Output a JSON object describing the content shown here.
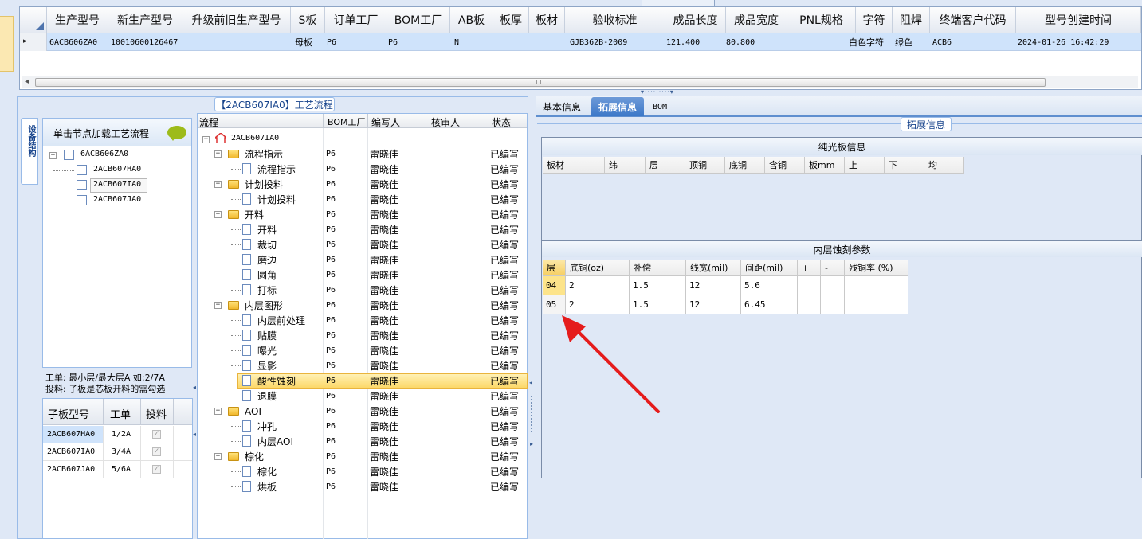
{
  "top_grid": {
    "columns": [
      "生产型号",
      "新生产型号",
      "升级前旧生产型号",
      "S板",
      "订单工厂",
      "BOM工厂",
      "AB板",
      "板厚",
      "板材",
      "验收标准",
      "成品长度",
      "成品宽度",
      "PNL规格",
      "字符",
      "阻焊",
      "终端客户代码",
      "型号创建时间"
    ],
    "row": {
      "prod_model": "6ACB606ZA0",
      "new_model": "10010600126467",
      "old_model": "",
      "s_board": "母板",
      "order_factory": "P6",
      "bom_factory": "P6",
      "ab_board": "N",
      "thickness": "",
      "material": "",
      "standard": "GJB362B-2009",
      "length": "121.400",
      "width": "80.800",
      "pnl": "",
      "char": "白色字符",
      "mask": "绿色",
      "customer": "ACB6",
      "created": "2024-01-26 16:42:29"
    }
  },
  "side_tab": {
    "label": "设备结构"
  },
  "left_panel": {
    "hint": "单击节点加载工艺流程",
    "tree": {
      "root": "6ACB606ZA0",
      "children": [
        "2ACB607HA0",
        "2ACB607IA0",
        "2ACB607JA0"
      ]
    },
    "notes": [
      "工单: 最小层/最大层A 如:2/7A",
      "投料: 子板是芯板开料的需勾选"
    ],
    "sub_table": {
      "headers": [
        "子板型号",
        "工单",
        "投料"
      ],
      "rows": [
        {
          "model": "2ACB607HA0",
          "order": "1/2A",
          "checked": "✓"
        },
        {
          "model": "2ACB607IA0",
          "order": "3/4A",
          "checked": "✓"
        },
        {
          "model": "2ACB607JA0",
          "order": "5/6A",
          "checked": "✓"
        }
      ]
    }
  },
  "process_panel": {
    "title": "【2ACB607IA0】工艺流程",
    "headers": [
      "流程",
      "BOM工厂",
      "编写人",
      "核审人",
      "状态"
    ],
    "root": "2ACB607IA0",
    "rows": [
      {
        "name": "流程指示",
        "level": 1,
        "type": "folder",
        "bom": "P6",
        "writer": "雷晓佳",
        "status": "已编写"
      },
      {
        "name": "流程指示",
        "level": 2,
        "type": "file",
        "bom": "P6",
        "writer": "雷晓佳",
        "status": "已编写"
      },
      {
        "name": "计划投料",
        "level": 1,
        "type": "folder",
        "bom": "P6",
        "writer": "雷晓佳",
        "status": "已编写"
      },
      {
        "name": "计划投料",
        "level": 2,
        "type": "file",
        "bom": "P6",
        "writer": "雷晓佳",
        "status": "已编写"
      },
      {
        "name": "开料",
        "level": 1,
        "type": "folder",
        "bom": "P6",
        "writer": "雷晓佳",
        "status": "已编写"
      },
      {
        "name": "开料",
        "level": 2,
        "type": "file",
        "bom": "P6",
        "writer": "雷晓佳",
        "status": "已编写"
      },
      {
        "name": "裁切",
        "level": 2,
        "type": "file",
        "bom": "P6",
        "writer": "雷晓佳",
        "status": "已编写"
      },
      {
        "name": "磨边",
        "level": 2,
        "type": "file",
        "bom": "P6",
        "writer": "雷晓佳",
        "status": "已编写"
      },
      {
        "name": "圆角",
        "level": 2,
        "type": "file",
        "bom": "P6",
        "writer": "雷晓佳",
        "status": "已编写"
      },
      {
        "name": "打标",
        "level": 2,
        "type": "file",
        "bom": "P6",
        "writer": "雷晓佳",
        "status": "已编写"
      },
      {
        "name": "内层图形",
        "level": 1,
        "type": "folder",
        "bom": "P6",
        "writer": "雷晓佳",
        "status": "已编写"
      },
      {
        "name": "内层前处理",
        "level": 2,
        "type": "file",
        "bom": "P6",
        "writer": "雷晓佳",
        "status": "已编写"
      },
      {
        "name": "贴膜",
        "level": 2,
        "type": "file",
        "bom": "P6",
        "writer": "雷晓佳",
        "status": "已编写"
      },
      {
        "name": "曝光",
        "level": 2,
        "type": "file",
        "bom": "P6",
        "writer": "雷晓佳",
        "status": "已编写"
      },
      {
        "name": "显影",
        "level": 2,
        "type": "file",
        "bom": "P6",
        "writer": "雷晓佳",
        "status": "已编写"
      },
      {
        "name": "酸性蚀刻",
        "level": 2,
        "type": "file",
        "bom": "P6",
        "writer": "雷晓佳",
        "status": "已编写"
      },
      {
        "name": "退膜",
        "level": 2,
        "type": "file",
        "bom": "P6",
        "writer": "雷晓佳",
        "status": "已编写"
      },
      {
        "name": "AOI",
        "level": 1,
        "type": "folder",
        "bom": "P6",
        "writer": "雷晓佳",
        "status": "已编写"
      },
      {
        "name": "冲孔",
        "level": 2,
        "type": "file",
        "bom": "P6",
        "writer": "雷晓佳",
        "status": "已编写"
      },
      {
        "name": "内层AOI",
        "level": 2,
        "type": "file",
        "bom": "P6",
        "writer": "雷晓佳",
        "status": "已编写"
      },
      {
        "name": "棕化",
        "level": 1,
        "type": "folder",
        "bom": "P6",
        "writer": "雷晓佳",
        "status": "已编写"
      },
      {
        "name": "棕化",
        "level": 2,
        "type": "file",
        "bom": "P6",
        "writer": "雷晓佳",
        "status": "已编写"
      },
      {
        "name": "烘板",
        "level": 2,
        "type": "file",
        "bom": "P6",
        "writer": "雷晓佳",
        "status": "已编写"
      }
    ],
    "selected_index": 15
  },
  "right_panel": {
    "tabs": [
      "基本信息",
      "拓展信息",
      "BOM"
    ],
    "active_tab": "拓展信息",
    "group_title": "拓展信息",
    "bare_board": {
      "title": "纯光板信息",
      "headers": [
        "板材",
        "纬",
        "层",
        "顶铜",
        "底铜",
        "含铜",
        "板mm",
        "上",
        "下",
        "均"
      ]
    },
    "etching": {
      "title": "内层蚀刻参数",
      "headers": [
        "层",
        "底铜(oz)",
        "补偿",
        "线宽(mil)",
        "间距(mil)",
        "+",
        "-",
        "残铜率 (%)"
      ],
      "rows": [
        [
          "04",
          "2",
          "1.5",
          "12",
          "5.6",
          "",
          "",
          ""
        ],
        [
          "05",
          "2",
          "1.5",
          "12",
          "6.45",
          "",
          "",
          ""
        ]
      ]
    }
  },
  "colors": {
    "selection": "#cfe3fb",
    "highlight": "#fde48a",
    "arrow": "#e51c1c",
    "accent": "#3c78c8"
  }
}
